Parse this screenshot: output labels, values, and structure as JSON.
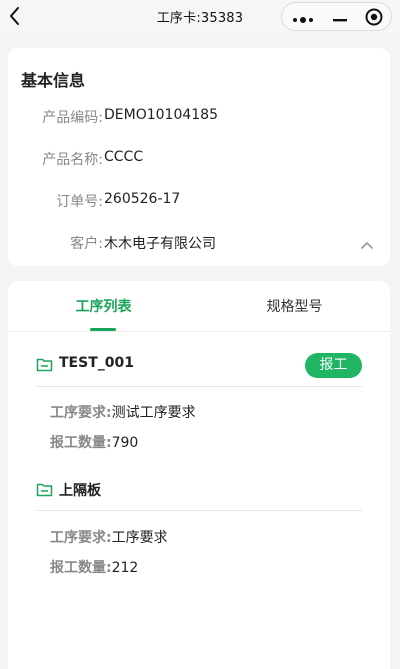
{
  "nav": {
    "title": "工序卡:35383"
  },
  "info": {
    "title": "基本信息",
    "rows": [
      {
        "label": "产品编码:",
        "value": "DEMO10104185"
      },
      {
        "label": "产品名称:",
        "value": "CCCC"
      },
      {
        "label": "订单号:",
        "value": "260526-17"
      },
      {
        "label": "客户:",
        "value": "木木电子有限公司"
      }
    ]
  },
  "tabs": [
    {
      "label": "工序列表",
      "active": true
    },
    {
      "label": "规格型号",
      "active": false
    }
  ],
  "processes": [
    {
      "name": "TEST_001",
      "action_label": "报工",
      "requirement_label": "工序要求:",
      "requirement": "测试工序要求",
      "quantity_label": "报工数量:",
      "quantity": "790"
    },
    {
      "name": "上隔板",
      "requirement_label": "工序要求:",
      "requirement": "工序要求",
      "quantity_label": "报工数量:",
      "quantity": "212"
    }
  ],
  "colors": {
    "accent": "#1aa35a",
    "button": "#1fb563",
    "background": "#f4f4f5"
  },
  "icons": [
    "back-arrow-icon",
    "more-dots-icon",
    "minimize-icon",
    "target-icon",
    "chevron-up-icon",
    "folder-icon"
  ]
}
